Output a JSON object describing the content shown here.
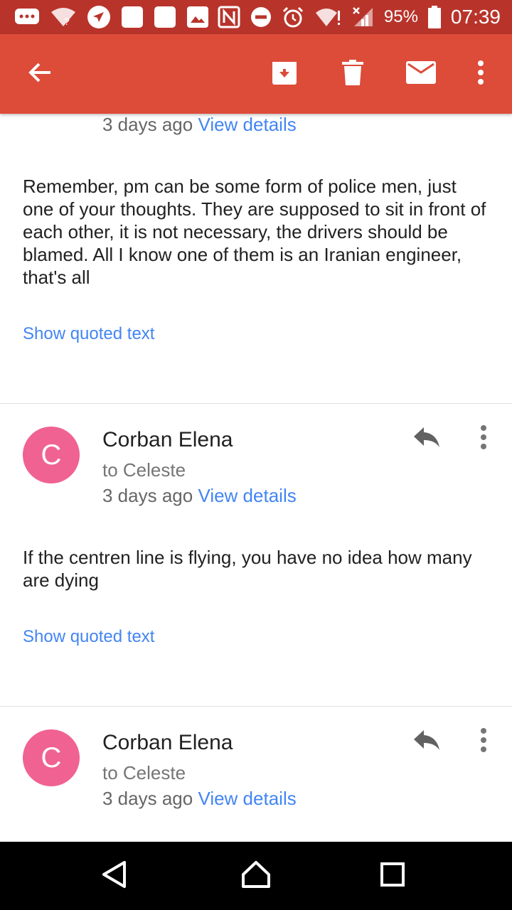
{
  "status_bar": {
    "battery": "95%",
    "time": "07:39",
    "icons": [
      "chat-icon",
      "wifi-question-icon",
      "navigation-icon",
      "app-square-icon",
      "app-square-icon",
      "gallery-icon",
      "nfc-icon",
      "do-not-disturb-icon",
      "alarm-icon",
      "wifi-icon",
      "signal-icon",
      "battery-icon"
    ]
  },
  "app_bar": {
    "icons": [
      "back-arrow-icon",
      "archive-icon",
      "delete-icon",
      "mark-unread-icon",
      "more-vert-icon"
    ],
    "color": "#dd4b39"
  },
  "messages": [
    {
      "time": "3 days ago",
      "details_link": "View details",
      "body": "Remember, pm can be some form of police men, just one of your thoughts. They are supposed to sit in front of each other, it is not necessary, the drivers should be blamed. All I know one of them is an Iranian engineer, that's all",
      "quoted": "Show quoted text"
    },
    {
      "avatar_letter": "C",
      "sender": "Corban Elena",
      "recipient": "to Celeste",
      "time": "3 days ago",
      "details_link": "View details",
      "body": "If the centren line is flying, you have no idea how many are dying",
      "quoted": "Show quoted text"
    },
    {
      "avatar_letter": "C",
      "sender": "Corban Elena",
      "recipient": "to Celeste",
      "time": "3 days ago",
      "details_link": "View details"
    }
  ],
  "colors": {
    "status_bar": "#b8342b",
    "app_bar": "#dd4b39",
    "avatar": "#f06292",
    "link": "#4285f4"
  },
  "nav_bar": {
    "icons": [
      "back-triangle-icon",
      "home-icon",
      "recents-icon"
    ]
  }
}
